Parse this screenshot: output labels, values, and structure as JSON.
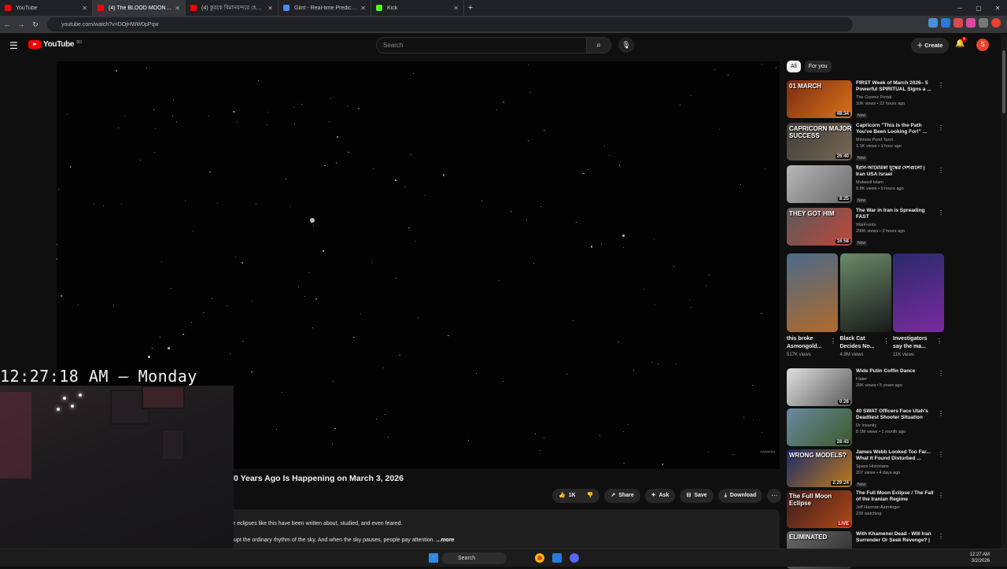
{
  "browser": {
    "tabs": [
      {
        "label": "YouTube",
        "color": "#ff0000",
        "active": false
      },
      {
        "label": "(4) The BLOOD MOON Pro",
        "color": "#ff0000",
        "active": true
      },
      {
        "label": "(4) কুরকে বিমানবন্দরে হেলে যা",
        "color": "#ff0000",
        "active": false
      },
      {
        "label": "Glint - Real-time Prediction",
        "color": "#4d8bff",
        "active": false
      },
      {
        "label": "Kick",
        "color": "#53fc18",
        "active": false
      }
    ],
    "url": "youtube.com/watch?v=DOjHWW0pPqw"
  },
  "header": {
    "logo_text": "YouTube",
    "logo_sup": "BD",
    "search_placeholder": "Search",
    "create_label": "Create",
    "notification_count": "4",
    "avatar_letter": "S"
  },
  "overlay": {
    "clock_text": "12:27:18 AM – Monday"
  },
  "video": {
    "title": "0 Years Ago Is Happening on March 3, 2026",
    "watermark": "ΔΔΔΔΔΔΔ",
    "like_count": "1K",
    "share_label": "Share",
    "ask_label": "Ask",
    "save_label": "Save",
    "download_label": "Download",
    "desc_line1": "r eclipses like this have been written about, studied, and even feared.",
    "desc_line2": "upt the ordinary rhythm of the sky. And when the sky pauses, people pay attention.",
    "more_label": "...more"
  },
  "chips": [
    "All",
    "For you"
  ],
  "recommendations": [
    {
      "title": "FIRST Week of March 2026– 5 Powerful SPIRITUAL Signs a ...",
      "channel": "The Cosmic Portal",
      "meta": "10K views • 22 hours ago",
      "badge": "New",
      "duration": "48:34",
      "thumb_text": "01 MARCH",
      "colors": [
        "#7a2a10",
        "#d9731a"
      ]
    },
    {
      "title": "Capricorn \"This Is the Path You've Been Looking For!\" ...",
      "channel": "Minnow Pond Tarot",
      "meta": "1.1K views • 1 hour ago",
      "badge": "New",
      "duration": "26:40",
      "thumb_text": "CAPRICORN MAJOR SUCCESS",
      "colors": [
        "#3c3a38",
        "#7a6a55"
      ]
    },
    {
      "title": "ইরান-আমেরিকা যুদ্ধের দেশগুলো | Iran USA Israel",
      "channel": "Mufassil Islam",
      "meta": "9.8K views • 9 hours ago",
      "badge": "New",
      "duration": "8:25",
      "thumb_text": "",
      "colors": [
        "#b8b8b8",
        "#6a6a6a"
      ]
    },
    {
      "title": "The War in Iran is Spreading FAST",
      "channel": "WarFronts",
      "meta": "290K views • 3 hours ago",
      "badge": "New",
      "duration": "16:58",
      "thumb_text": "THEY GOT HIM",
      "colors": [
        "#5a5a5a",
        "#c0463a"
      ]
    }
  ],
  "shorts": [
    {
      "title": "this broke Asmongold...",
      "views": "517K views",
      "colors": [
        "#4a6a8a",
        "#b06a2a"
      ]
    },
    {
      "title": "Black Cat Decides No...",
      "views": "4.9M views",
      "colors": [
        "#6a8a6a",
        "#1a1a1a"
      ]
    },
    {
      "title": "Investigators say the ma...",
      "views": "11K views",
      "colors": [
        "#2a2a6a",
        "#7a2aa0"
      ]
    }
  ],
  "recommendations2": [
    {
      "title": "Wide Putin Coffin Dance",
      "channel": "Flater",
      "meta": "29K views • 5 years ago",
      "badge": "",
      "duration": "0:26",
      "thumb_text": "",
      "colors": [
        "#e0e0e0",
        "#5a5a5a"
      ]
    },
    {
      "title": "40 SWAT Officers Face Utah's Deadliest Shooter Situation",
      "channel": "Dr Insanity",
      "meta": "8.1M views • 1 month ago",
      "badge": "",
      "duration": "28:43",
      "thumb_text": "",
      "colors": [
        "#6a8aa0",
        "#3a5a2a"
      ]
    },
    {
      "title": "James Webb Looked Too Far... What It Found Disturbed ...",
      "channel": "Space Historians",
      "meta": "207 views • 4 days ago",
      "badge": "New",
      "duration": "2:29:24",
      "thumb_text": "WRONG MODELS?",
      "colors": [
        "#1a2a6a",
        "#c07a1a"
      ]
    },
    {
      "title": "The Full Moon Eclipse / The Fall of the Iranian Regime",
      "channel": "Jeff Harman Astrologer",
      "meta": "238 watching",
      "badge": "",
      "duration": "LIVE",
      "thumb_text": "The Full Moon Eclipse",
      "colors": [
        "#3a1a1a",
        "#b04a1a"
      ]
    },
    {
      "title": "With Khamenei Dead - Will Iran Surrender Or Seek Revenge? | ...",
      "channel": "",
      "meta": "",
      "badge": "",
      "duration": "",
      "thumb_text": "ELIMINATED",
      "colors": [
        "#6a6a6a",
        "#2a2a2a"
      ]
    }
  ],
  "taskbar": {
    "search_label": "Search",
    "time": "12:27 AM",
    "date": "3/2/2026"
  }
}
